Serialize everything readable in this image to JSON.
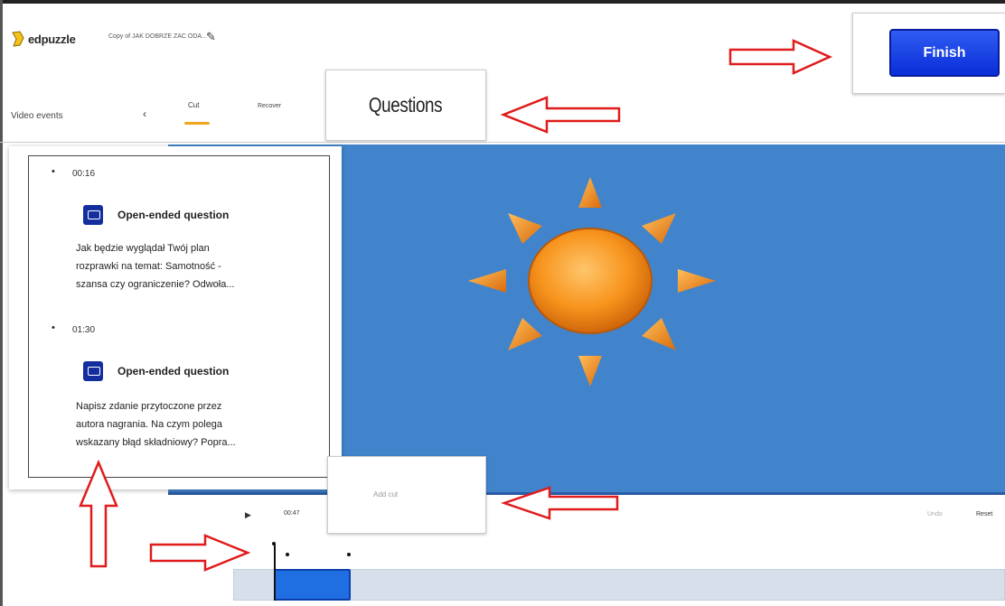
{
  "header": {
    "logo_text": "edpuzzle",
    "doc_title": "Copy of JAK DOBRZE ZAC ODA...",
    "edit_icon": "pencil-icon"
  },
  "tabs": {
    "video_events": "Video events",
    "back_icon": "‹",
    "cut": "Cut",
    "recover": "Recover"
  },
  "popups": {
    "questions": "Questions",
    "finish": "Finish",
    "add_cut": "Add cut"
  },
  "events": [
    {
      "time": "00:16",
      "type": "Open-ended question",
      "text_lines": [
        "Jak będzie wyglądał Twój plan",
        "rozprawki na temat: Samotność -",
        "szansa czy ograniczenie? Odwoła..."
      ]
    },
    {
      "time": "01:30",
      "type": "Open-ended question",
      "text_lines": [
        "Napisz zdanie przytoczone przez",
        "autora nagrania. Na czym polega",
        "wskazany błąd składniowy? Popra..."
      ]
    }
  ],
  "controls": {
    "play_icon": "▶",
    "time_code": "00:47",
    "undo": "Undo",
    "reset": "Reset"
  },
  "colors": {
    "video_bg": "#4184cc",
    "finish_button": "#0a2ed8",
    "accent": "#f2a51f",
    "arrow": "#e01b1b",
    "question_icon": "#142e9e"
  }
}
